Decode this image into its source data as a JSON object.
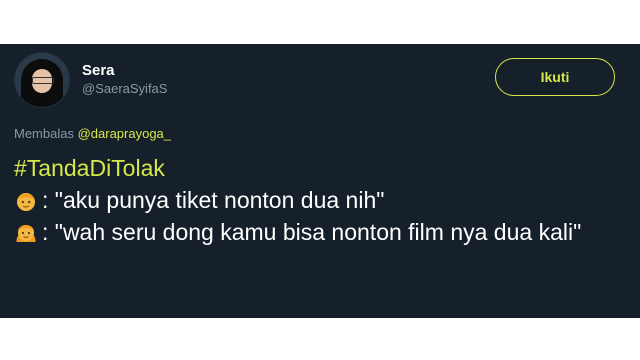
{
  "user": {
    "display_name": "Sera",
    "handle": "@SaeraSyifaS"
  },
  "follow_button": {
    "label": "Ikuti",
    "color": "#d6e84a"
  },
  "reply": {
    "prefix": "Membalas",
    "mention": "@daraprayoga_"
  },
  "tweet": {
    "hashtag": "#TandaDiTolak",
    "lines": [
      {
        "emoji": "boy-emoji",
        "text": ": \"aku punya tiket nonton dua nih\""
      },
      {
        "emoji": "girl-emoji",
        "text": ": \"wah seru dong kamu bisa nonton film nya dua kali\""
      }
    ]
  },
  "colors": {
    "background": "#15202b",
    "accent": "#d6e84a",
    "secondary_text": "#8899a6"
  }
}
